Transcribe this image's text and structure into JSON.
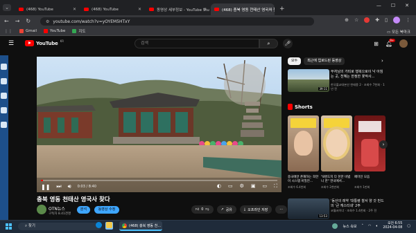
{
  "browser": {
    "tabs": [
      {
        "title": "(468) YouTube",
        "active": false
      },
      {
        "title": "(468) YouTube",
        "active": false
      },
      {
        "title": "동영상 세부정보 - YouTube Studio",
        "active": false
      },
      {
        "title": "(468) 충북 영동 천태산 영국사 찾다",
        "active": true
      }
    ],
    "url": "youtube.com/watch?v=yOYEM5HTxY",
    "bookmarks": [
      {
        "label": "Gmail",
        "color": "#ea4335"
      },
      {
        "label": "YouTube",
        "color": "#ff0000"
      },
      {
        "label": "지도",
        "color": "#34a853"
      }
    ],
    "all_bookmarks": "모든 북마크"
  },
  "youtube": {
    "logo_text": "YouTube",
    "logo_region": "KR",
    "search_placeholder": "검색",
    "notification_count": "9+"
  },
  "video": {
    "title": "충북 영동 천태산 영국사 찾다",
    "current_time": "0:03 / 8:40",
    "progress_percent": 1,
    "channel_name": "OTN뉴스",
    "subscribers": "구독자 8.41천명",
    "subscribe_label": "분석",
    "join_label": "동영상 수정",
    "like_count": "0",
    "share_label": "공유",
    "download_label": "오프라인 저장",
    "more_label": "⋯"
  },
  "sidebar": {
    "chips": [
      {
        "label": "모두",
        "selected": true
      },
      {
        "label": "최근에 업로드된 동영상",
        "selected": false
      }
    ],
    "recommendations": [
      {
        "title": "부처님의 가피로 행복으로이 낙 아침는 곳, 천혜는 한정한 꽃작사…",
        "meta": "한국불교대본산 천태종 2 · 조회수 7천회 · 1년 전",
        "duration": "39:11"
      }
    ],
    "shorts_heading": "Shorts",
    "shorts": [
      {
        "title": "중국에만 존재하는 희한 이 시스템 비밀만…",
        "views": "조회수 6.4천회"
      },
      {
        "title": "\"8명도지 다 천한 비법니 한\" 한국에서…",
        "views": "조회수 2천만회"
      },
      {
        "title": "페미인 모음",
        "views": "조회수 1만회"
      }
    ],
    "bottom_recommendations": [
      {
        "title": "'동산의 레약 '대통령 찰서 양 갓 번드의 '큰 캐스티네' 2주",
        "meta": "코월서이너 · 조회수 1.4천회 · 2주 전",
        "duration": "13:53"
      }
    ]
  },
  "taskbar": {
    "search_label": "찾기",
    "active_window": "(468) 충북 영동 천…",
    "news_label": "뉴스 속보",
    "time": "오전 6:55",
    "date": "2024-04-08"
  },
  "colors": {
    "youtube_red": "#ff0000",
    "accent_blue": "#3ea6ff",
    "background": "#0f0f0f"
  }
}
